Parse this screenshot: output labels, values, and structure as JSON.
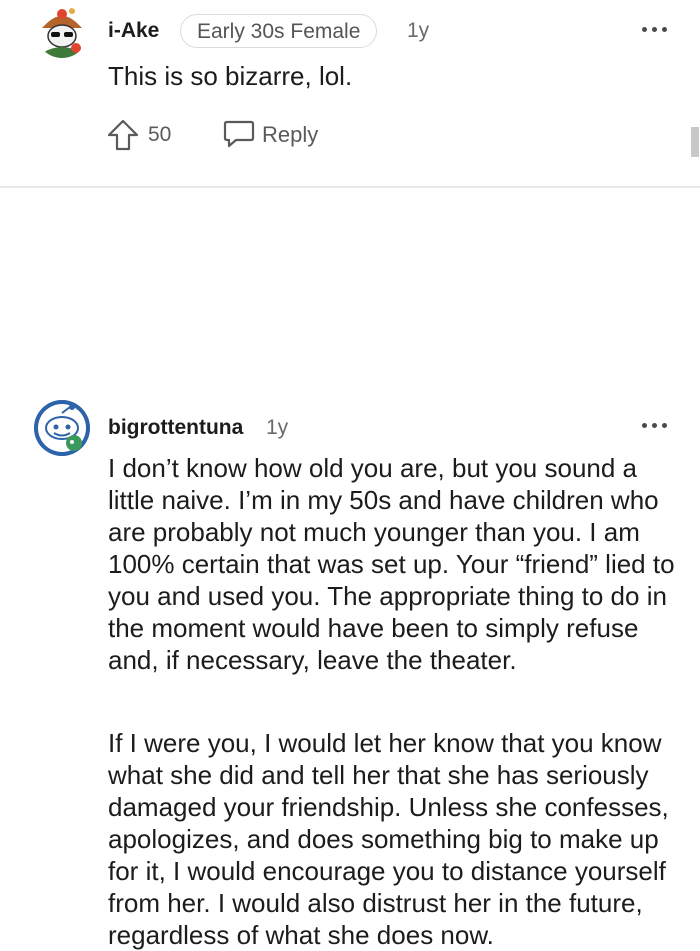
{
  "comments": [
    {
      "username": "i-Ake",
      "flair": "Early 30s Female",
      "age": "1y",
      "text": "This is so bizarre, lol.",
      "upvotes": "50",
      "reply_label": "Reply"
    },
    {
      "username": "bigrottentuna",
      "age": "1y",
      "paragraphs": [
        "I don’t know how old you are, but you sound a little naive. I’m in my 50s and have children who are probably not much younger than you. I am 100% certain that was set up. Your “friend” lied to you and used you. The appropriate thing to do in the moment would have been to simply refuse and, if necessary, leave the theater.",
        "If I were you, I would let her know that you know what she did and tell her that she has seriously damaged your friendship. Unless she confesses, apologizes, and does something big to make up for it, I would encourage you to distance yourself from her. I would also distrust her in the future, regardless of what she does now."
      ]
    }
  ],
  "icons": {
    "upvote": "upvote-arrow-icon",
    "reply": "speech-bubble-icon",
    "more": "more-options-icon",
    "avatar1": "snoo-avatar-cowboy",
    "avatar2": "snoo-avatar-fish"
  },
  "colors": {
    "text": "#1c1c1c",
    "meta": "#6b6b6b",
    "avatar2_bg": "#2d63a8",
    "divider": "#e9e9e9"
  }
}
